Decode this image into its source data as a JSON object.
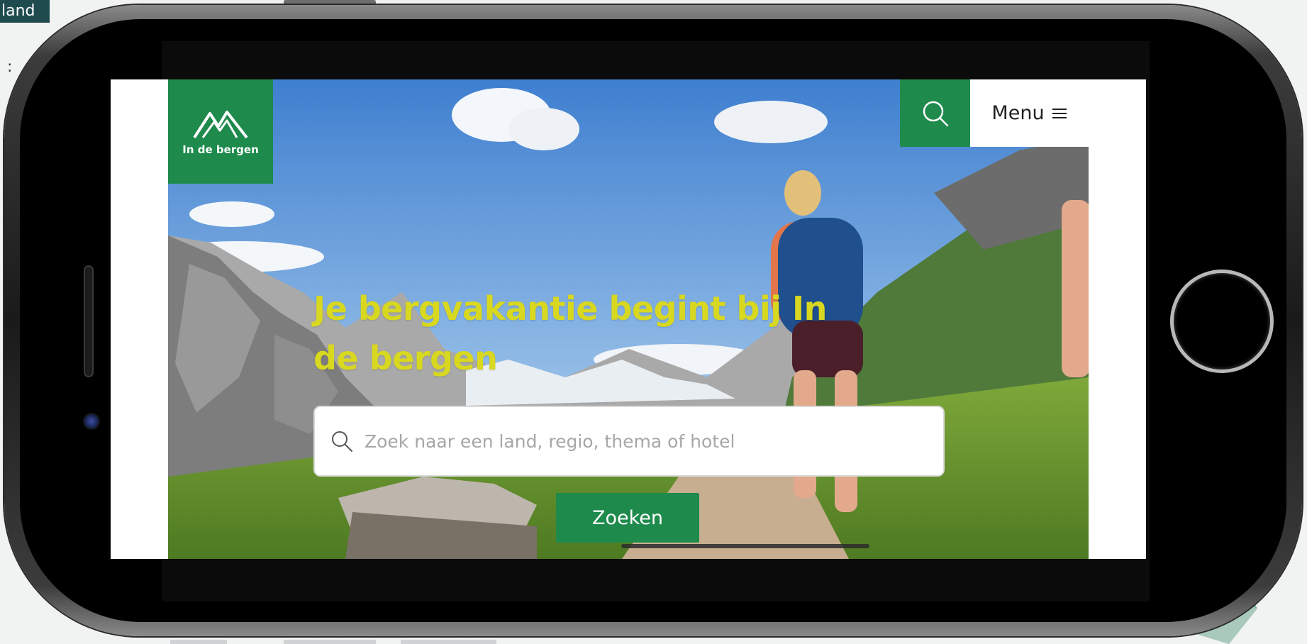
{
  "background_page": {
    "tab_label": "land",
    "dots": ":"
  },
  "site": {
    "logo_text": "In de bergen",
    "menu_label": "Menu",
    "headline": "Je bergvakantie begint bij In de bergen",
    "search": {
      "placeholder": "Zoek naar een land, regio, thema of hotel",
      "value": ""
    },
    "search_button_label": "Zoeken"
  },
  "icons": {
    "logo": "mountain-icon",
    "header_search": "search-icon",
    "menu": "hamburger-icon",
    "search_bar": "search-icon"
  },
  "colors": {
    "brand_green": "#1e8a4c",
    "headline_yellow": "#d8d820",
    "device_black": "#000000",
    "placeholder_gray": "#a7a7a7"
  }
}
